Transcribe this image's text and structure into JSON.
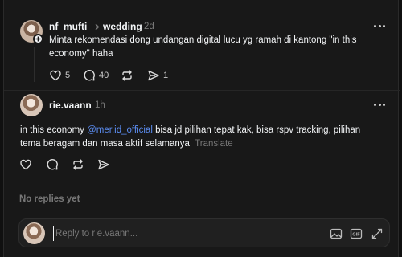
{
  "original_post": {
    "username": "nf_mufti",
    "topic": "wedding",
    "time": "2d",
    "text": "Minta rekomendasi dong undangan digital lucu yg ramah di kantong \"in this economy\" haha",
    "likes": "5",
    "comments": "40",
    "shares": "1"
  },
  "reply": {
    "username": "rie.vaann",
    "time": "1h",
    "text_before": "in this economy ",
    "mention": "@mer.id_official",
    "text_after": " bisa jd pilihan tepat kak, bisa rspv tracking, pilihan tema beragam dan masa aktif selamanya",
    "translate_label": "Translate"
  },
  "replies_section": {
    "empty_label": "No replies yet"
  },
  "composer": {
    "placeholder": "Reply to rie.vaann..."
  },
  "icons": {
    "more": "more-dots-icon",
    "like": "heart-icon",
    "comment": "comment-bubble-icon",
    "repost": "repost-icon",
    "share": "send-icon",
    "follow": "plus-icon",
    "topic": "chevron-right-icon",
    "gallery": "image-icon",
    "gif": "gif-icon",
    "expand": "expand-icon"
  },
  "colors": {
    "background": "#181818",
    "text": "#f3f5f7",
    "muted": "#777777",
    "mention": "#5b8cf0"
  }
}
